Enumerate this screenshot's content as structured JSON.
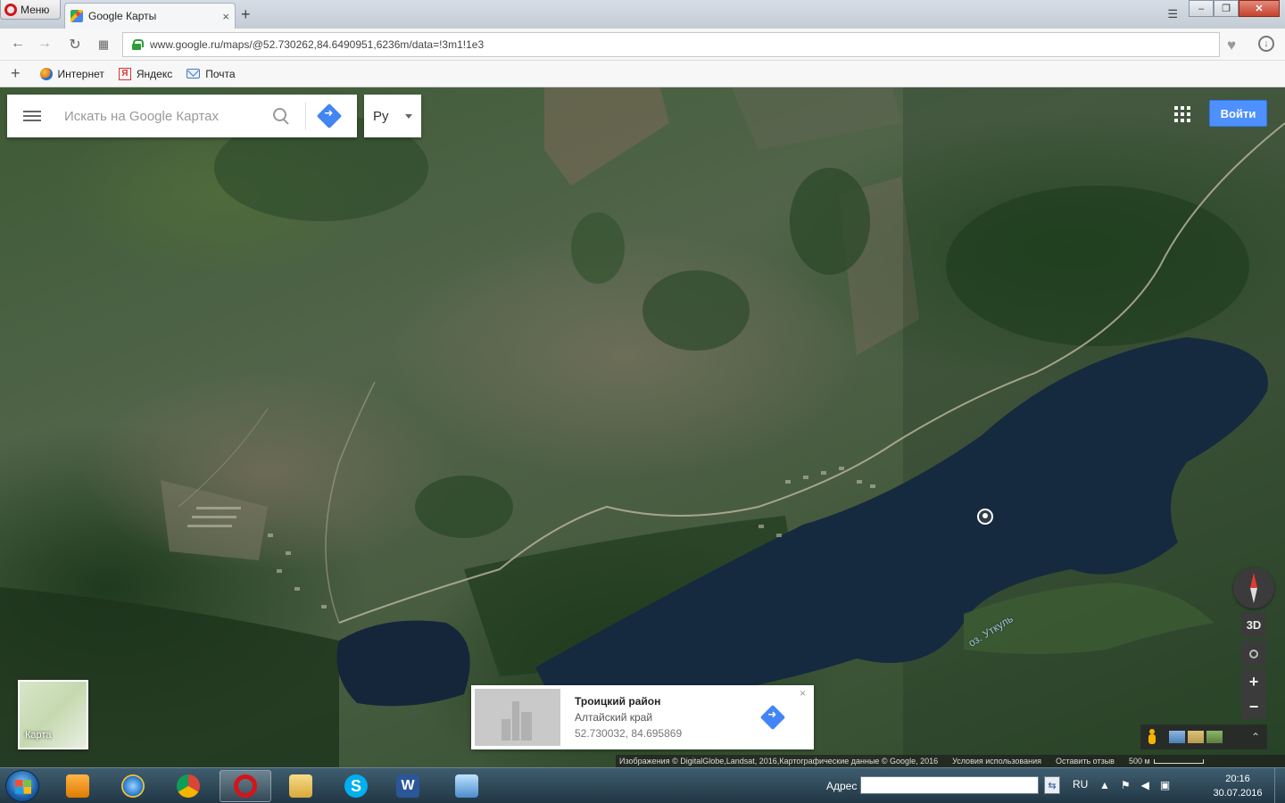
{
  "browser": {
    "menu_label": "Меню",
    "tab_title": "Google Карты",
    "tab_close": "×",
    "new_tab": "+",
    "url": "www.google.ru/maps/@52.730262,84.6490951,6236m/data=!3m1!1e3",
    "bookmarks": [
      {
        "label": "Интернет",
        "icon": "globe-icon"
      },
      {
        "label": "Яндекс",
        "icon": "yandex-icon"
      },
      {
        "label": "Почта",
        "icon": "mail-icon"
      }
    ]
  },
  "maps": {
    "search_placeholder": "Искать на Google Картах",
    "language": "Ру",
    "sign_in": "Войти",
    "lake_label": "оз. Уткуль",
    "minimap_label": "Карта",
    "control_3d": "3D",
    "zoom_in": "+",
    "zoom_out": "−",
    "place_card": {
      "title": "Троицкий район",
      "subtitle": "Алтайский край",
      "coords": "52.730032, 84.695869",
      "close": "×"
    },
    "attribution": {
      "imagery": "Изображения © DigitalGlobe,Landsat, 2016,Картографические данные © Google, 2016",
      "terms": "Условия использования",
      "feedback": "Оставить отзыв",
      "scale": "500 м"
    }
  },
  "taskbar": {
    "address_label": "Адрес",
    "language": "RU",
    "time": "20:16",
    "date": "30.07.2016"
  },
  "colors": {
    "signin_blue": "#4d90fe",
    "directions_blue": "#4285f4",
    "lake": "#152a3f"
  }
}
